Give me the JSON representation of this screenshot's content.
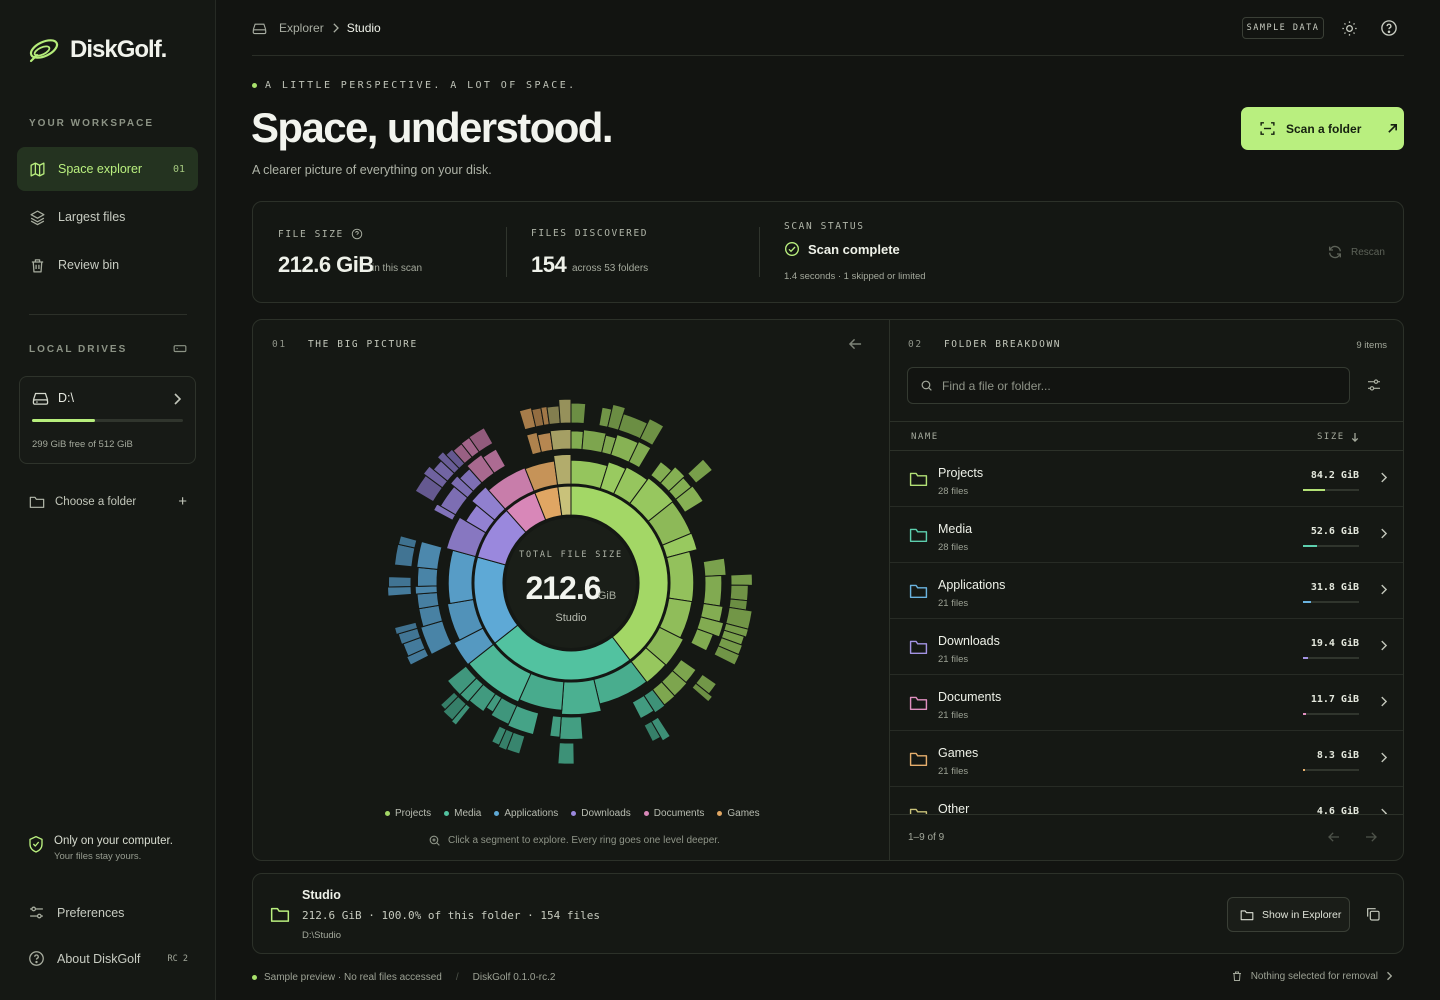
{
  "app": {
    "name": "DiskGolf."
  },
  "sidebar": {
    "workspace_heading": "YOUR WORKSPACE",
    "nav": [
      {
        "label": "Space explorer",
        "num": "01",
        "icon": "map-icon",
        "active": true
      },
      {
        "label": "Largest files",
        "icon": "layers-icon"
      },
      {
        "label": "Review bin",
        "icon": "trash-icon"
      }
    ],
    "drives_heading": "LOCAL DRIVES",
    "drive": {
      "name": "D:\\",
      "free_text": "299 GiB free of 512 GiB",
      "used_fraction": 0.416
    },
    "choose_folder": "Choose a folder",
    "privacy_title": "Only on your computer.",
    "privacy_sub": "Your files stay yours.",
    "preferences": "Preferences",
    "about": "About DiskGolf",
    "about_badge": "RC 2"
  },
  "topbar": {
    "breadcrumb": [
      "Explorer",
      "Studio"
    ],
    "sample_badge": "SAMPLE DATA"
  },
  "hero": {
    "eyebrow": "A LITTLE PERSPECTIVE. A LOT OF SPACE.",
    "title": "Space, understood.",
    "subtitle": "A clearer picture of everything on your disk.",
    "scan_button": "Scan a folder"
  },
  "stats": {
    "file_size_label": "FILE SIZE",
    "file_size_value": "212.6 GiB",
    "file_size_note": "in this scan",
    "files_label": "FILES DISCOVERED",
    "files_value": "154",
    "files_note": "across 53 folders",
    "status_label": "SCAN STATUS",
    "status_value": "Scan complete",
    "status_note": "1.4 seconds · 1 skipped or limited",
    "rescan": "Rescan"
  },
  "big_picture": {
    "num": "01",
    "heading": "THE BIG PICTURE",
    "center_label": "TOTAL FILE SIZE",
    "center_value": "212.6",
    "center_unit": "GiB",
    "center_name": "Studio",
    "hint": "Click a segment to explore. Every ring goes one level deeper."
  },
  "chart_data": {
    "type": "sunburst",
    "root": "Studio",
    "total": 212.6,
    "unit": "GiB",
    "series": [
      {
        "name": "Projects",
        "value": 84.2,
        "color": "#a3d766"
      },
      {
        "name": "Media",
        "value": 52.6,
        "color": "#52c2a0"
      },
      {
        "name": "Applications",
        "value": 31.8,
        "color": "#5ea9d6"
      },
      {
        "name": "Downloads",
        "value": 19.4,
        "color": "#9a88dd"
      },
      {
        "name": "Documents",
        "value": 11.7,
        "color": "#d887b8"
      },
      {
        "name": "Games",
        "value": 8.3,
        "color": "#e0a663"
      },
      {
        "name": "Other",
        "value": 4.6,
        "color": "#c9c27a"
      }
    ],
    "legend": [
      "Projects",
      "Media",
      "Applications",
      "Downloads",
      "Documents",
      "Games"
    ]
  },
  "breakdown": {
    "num": "02",
    "heading": "FOLDER BREAKDOWN",
    "count": "9 items",
    "search_placeholder": "Find a file or folder...",
    "col_name": "NAME",
    "col_size": "SIZE",
    "rows": [
      {
        "name": "Projects",
        "files": "28 files",
        "size": "84.2 GiB",
        "color": "#b3e176",
        "share": 0.396
      },
      {
        "name": "Media",
        "files": "28 files",
        "size": "52.6 GiB",
        "color": "#5dcfae",
        "share": 0.247
      },
      {
        "name": "Applications",
        "files": "21 files",
        "size": "31.8 GiB",
        "color": "#6ab3df",
        "share": 0.15
      },
      {
        "name": "Downloads",
        "files": "21 files",
        "size": "19.4 GiB",
        "color": "#a393e3",
        "share": 0.091
      },
      {
        "name": "Documents",
        "files": "21 files",
        "size": "11.7 GiB",
        "color": "#e08fbf",
        "share": 0.055
      },
      {
        "name": "Games",
        "files": "21 files",
        "size": "8.3 GiB",
        "color": "#e6ae6c",
        "share": 0.039
      },
      {
        "name": "Other",
        "files": "",
        "size": "4.6 GiB",
        "color": "#c9c27a",
        "share": 0.022
      }
    ],
    "pager": "1–9 of 9"
  },
  "selection": {
    "name": "Studio",
    "detail": "212.6 GiB · 100.0% of this folder · 154 files",
    "path": "D:\\Studio",
    "show_button": "Show in Explorer"
  },
  "footer": {
    "preview": "Sample preview · No real files accessed",
    "version": "DiskGolf 0.1.0-rc.2",
    "removal": "Nothing selected for removal"
  }
}
